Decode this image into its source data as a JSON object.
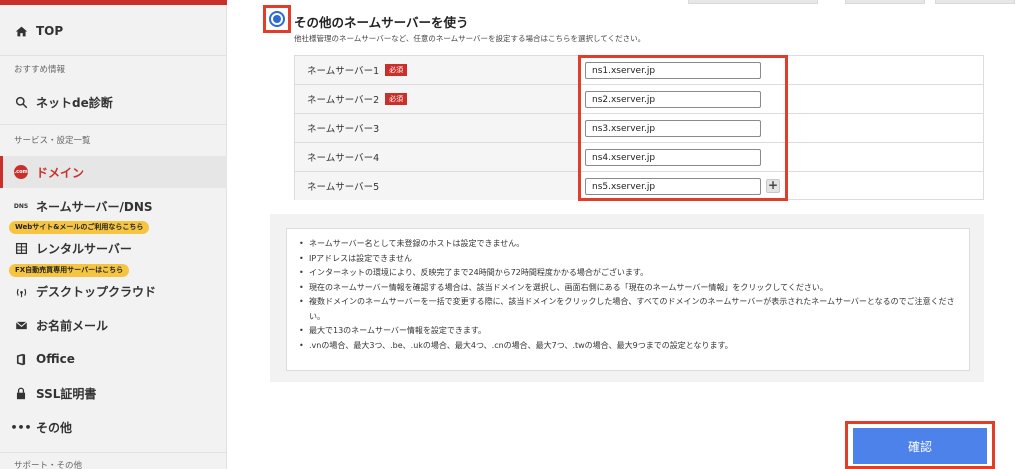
{
  "sidebar": {
    "top": "TOP",
    "section_recommend": "おすすめ情報",
    "net_diagnosis": "ネットde診断",
    "section_services": "サービス・設定一覧",
    "domain": "ドメイン",
    "domain_badge": ".com",
    "nameserver_dns": "ネームサーバー/DNS",
    "dns_icon_text": "DNS",
    "pill_web": "Webサイト&メールのご利用ならこちら",
    "rental_server": "レンタルサーバー",
    "pill_fx": "FX自動売買専用サーバーはこちら",
    "desktop_cloud": "デスクトップクラウド",
    "mail": "お名前メール",
    "office": "Office",
    "ssl": "SSL証明書",
    "other": "その他",
    "section_support": "サポート・その他"
  },
  "option": {
    "title": "その他のネームサーバーを使う",
    "description": "他社様管理のネームサーバーなど、任意のネームサーバーを設定する場合はこちらを選択してください。"
  },
  "nameservers": {
    "required_badge": "必須",
    "rows": [
      {
        "label": "ネームサーバー1",
        "value": "ns1.xserver.jp"
      },
      {
        "label": "ネームサーバー2",
        "value": "ns2.xserver.jp"
      },
      {
        "label": "ネームサーバー3",
        "value": "ns3.xserver.jp"
      },
      {
        "label": "ネームサーバー4",
        "value": "ns4.xserver.jp"
      },
      {
        "label": "ネームサーバー5",
        "value": "ns5.xserver.jp"
      }
    ],
    "add_label": "+"
  },
  "notes": [
    "ネームサーバー名として未登録のホストは設定できません。",
    "IPアドレスは設定できません",
    "インターネットの環境により、反映完了まで24時間から72時間程度かかる場合がございます。",
    "現在のネームサーバー情報を確認する場合は、該当ドメインを選択し、画面右側にある「現在のネームサーバー情報」をクリックしてください。",
    "複数ドメインのネームサーバーを一括で変更する際に、該当ドメインをクリックした場合、すべてのドメインのネームサーバーが表示されたネームサーバーとなるのでご注意ください。",
    "最大で13のネームサーバー情報を設定できます。",
    ".vnの場合、最大3つ、.be、.ukの場合、最大4つ、.cnの場合、最大7つ、.twの場合、最大9つまでの設定となります。"
  ],
  "confirm_label": "確認"
}
